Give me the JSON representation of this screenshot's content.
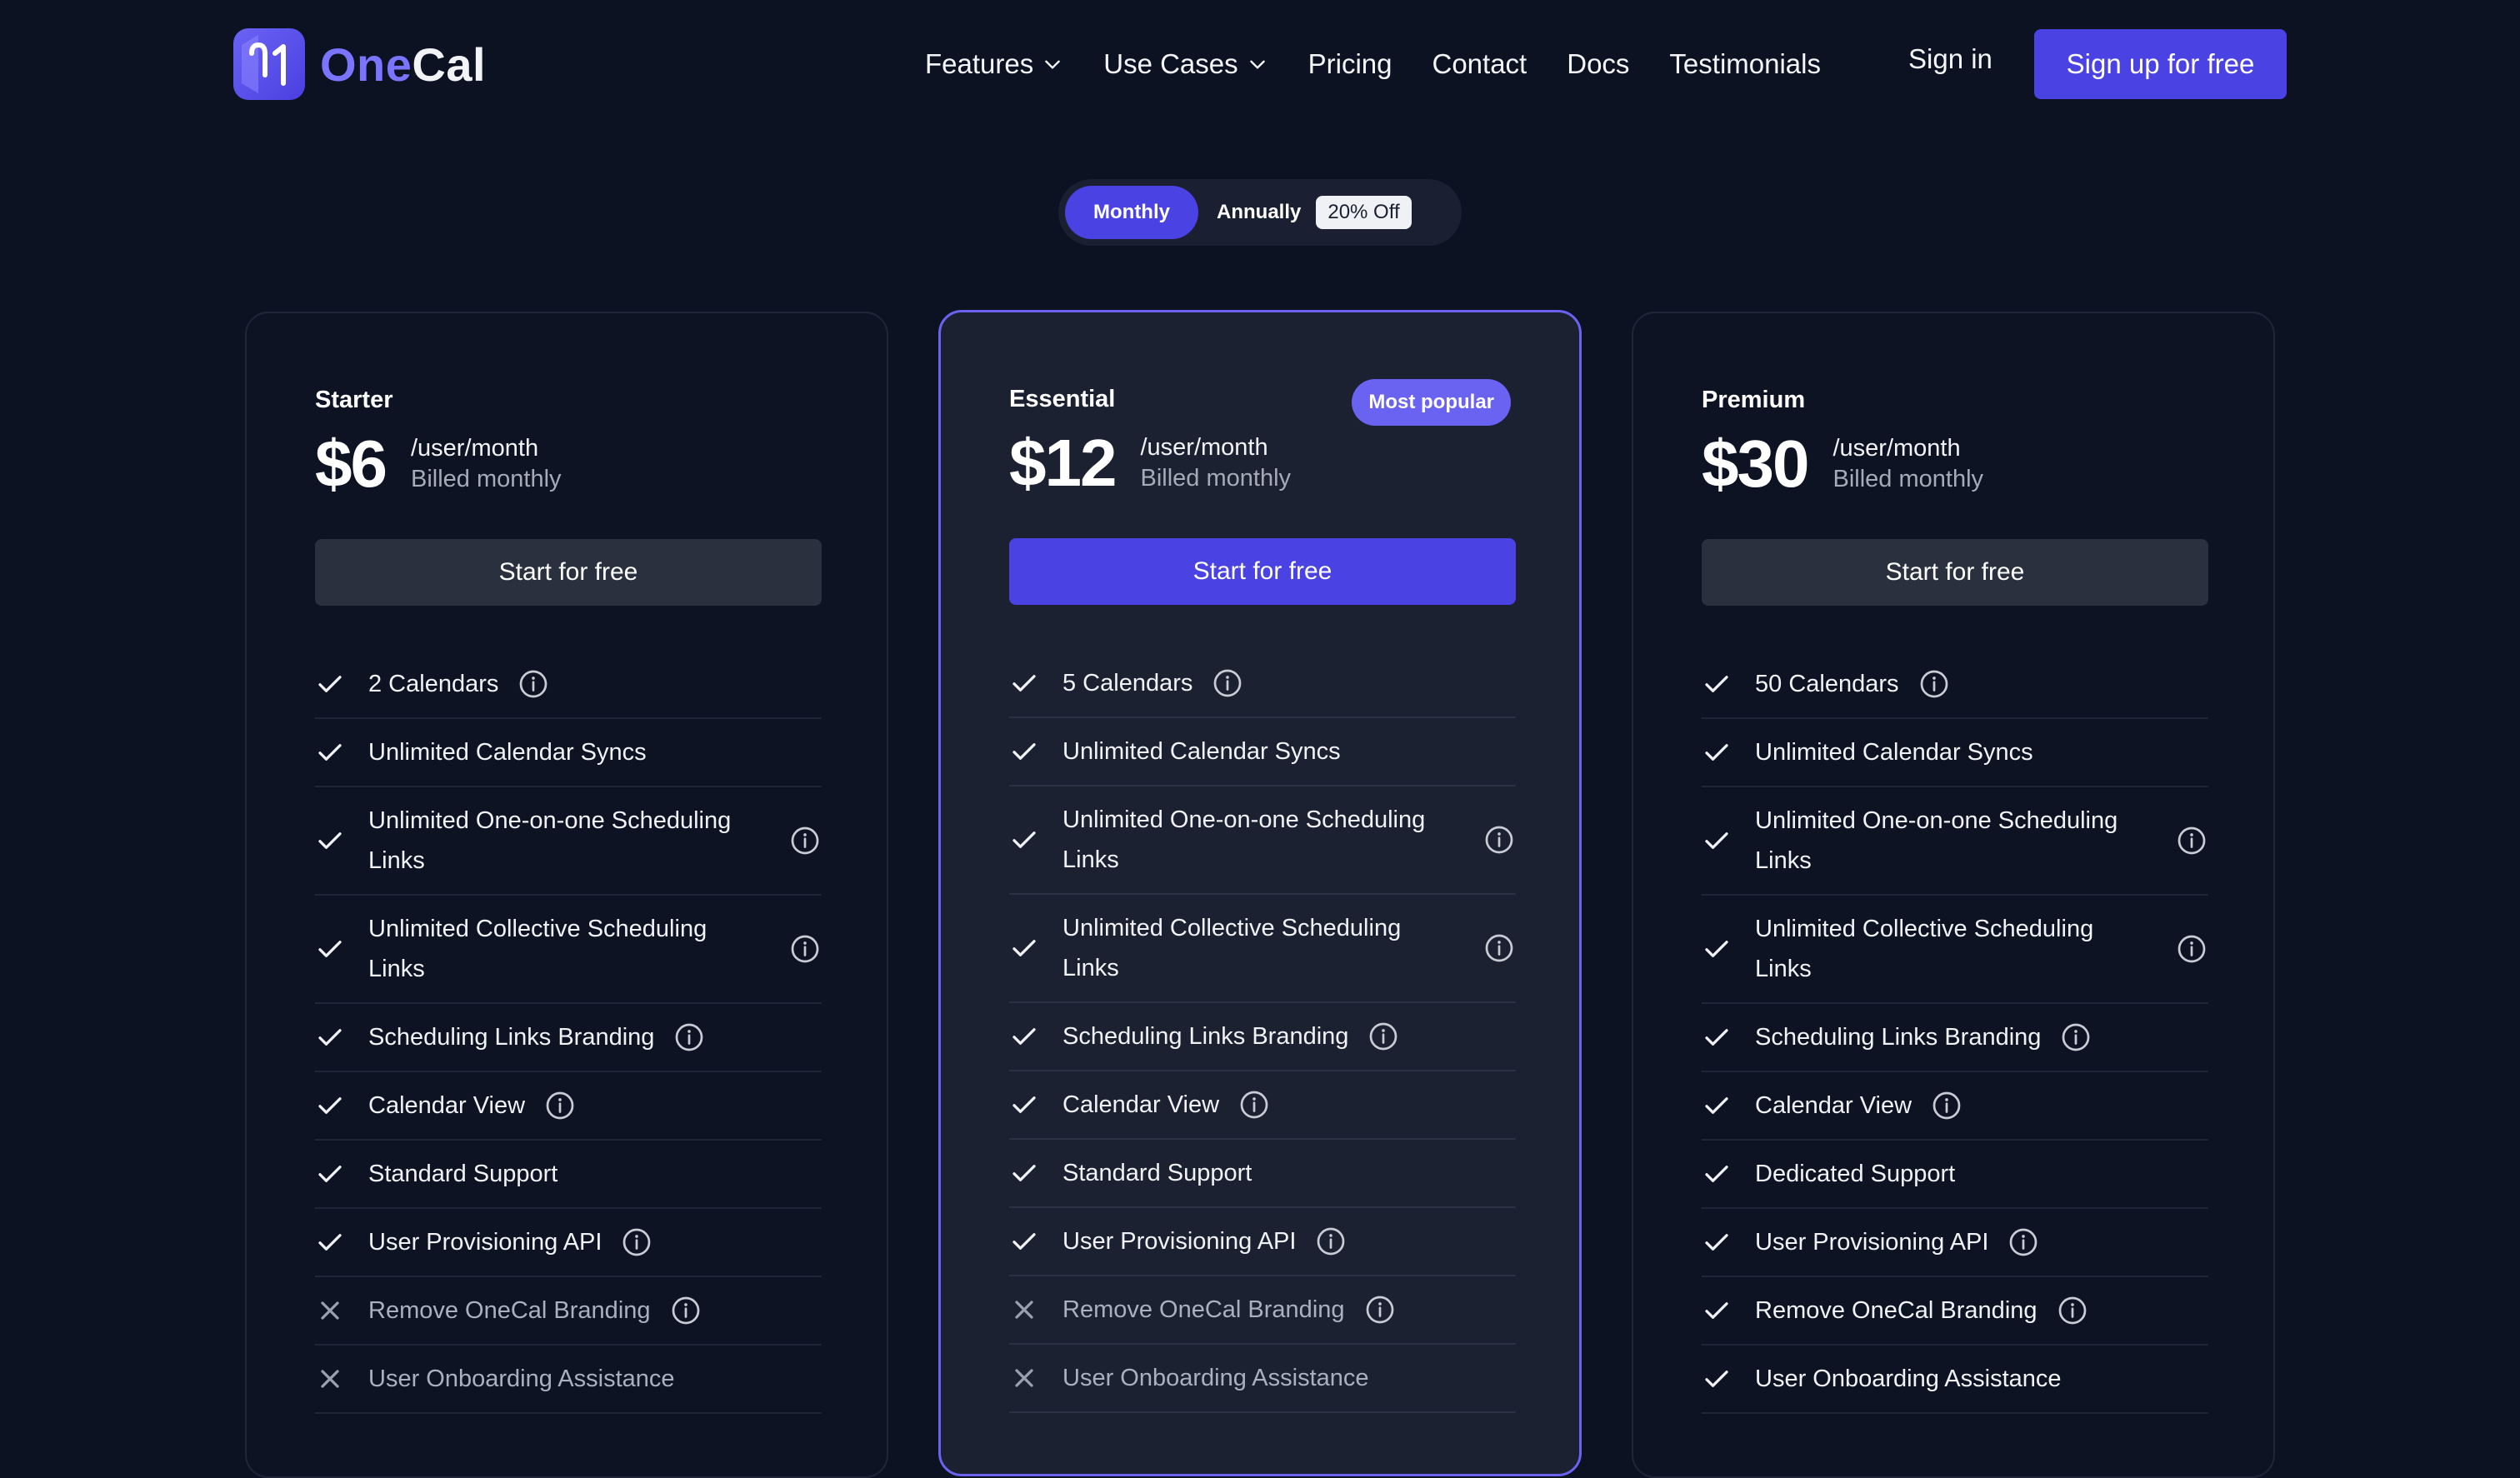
{
  "brand": {
    "one": "One",
    "cal": "Cal"
  },
  "nav": {
    "features": "Features",
    "use_cases": "Use Cases",
    "pricing": "Pricing",
    "contact": "Contact",
    "docs": "Docs",
    "testimonials": "Testimonials",
    "sign_in": "Sign in",
    "sign_up": "Sign up for free"
  },
  "billing_toggle": {
    "monthly": "Monthly",
    "annually": "Annually",
    "discount": "20% Off",
    "selected": "Monthly"
  },
  "plans": [
    {
      "name": "Starter",
      "price": "$6",
      "per": "/user/month",
      "billed": "Billed monthly",
      "cta": "Start for free",
      "features": [
        {
          "label": "2 Calendars",
          "included": true,
          "info": true
        },
        {
          "label": "Unlimited Calendar Syncs",
          "included": true,
          "info": false
        },
        {
          "label": "Unlimited One-on-one Scheduling Links",
          "included": true,
          "info": true
        },
        {
          "label": "Unlimited Collective Scheduling Links",
          "included": true,
          "info": true
        },
        {
          "label": "Scheduling Links Branding",
          "included": true,
          "info": true
        },
        {
          "label": "Calendar View",
          "included": true,
          "info": true
        },
        {
          "label": "Standard Support",
          "included": true,
          "info": false
        },
        {
          "label": "User Provisioning API",
          "included": true,
          "info": true
        },
        {
          "label": "Remove OneCal Branding",
          "included": false,
          "info": true
        },
        {
          "label": "User Onboarding Assistance",
          "included": false,
          "info": false
        }
      ]
    },
    {
      "name": "Essential",
      "price": "$12",
      "per": "/user/month",
      "billed": "Billed monthly",
      "cta": "Start for free",
      "badge": "Most popular",
      "features": [
        {
          "label": "5 Calendars",
          "included": true,
          "info": true
        },
        {
          "label": "Unlimited Calendar Syncs",
          "included": true,
          "info": false
        },
        {
          "label": "Unlimited One-on-one Scheduling Links",
          "included": true,
          "info": true
        },
        {
          "label": "Unlimited Collective Scheduling Links",
          "included": true,
          "info": true
        },
        {
          "label": "Scheduling Links Branding",
          "included": true,
          "info": true
        },
        {
          "label": "Calendar View",
          "included": true,
          "info": true
        },
        {
          "label": "Standard Support",
          "included": true,
          "info": false
        },
        {
          "label": "User Provisioning API",
          "included": true,
          "info": true
        },
        {
          "label": "Remove OneCal Branding",
          "included": false,
          "info": true
        },
        {
          "label": "User Onboarding Assistance",
          "included": false,
          "info": false
        }
      ]
    },
    {
      "name": "Premium",
      "price": "$30",
      "per": "/user/month",
      "billed": "Billed monthly",
      "cta": "Start for free",
      "features": [
        {
          "label": "50 Calendars",
          "included": true,
          "info": true
        },
        {
          "label": "Unlimited Calendar Syncs",
          "included": true,
          "info": false
        },
        {
          "label": "Unlimited One-on-one Scheduling Links",
          "included": true,
          "info": true
        },
        {
          "label": "Unlimited Collective Scheduling Links",
          "included": true,
          "info": true
        },
        {
          "label": "Scheduling Links Branding",
          "included": true,
          "info": true
        },
        {
          "label": "Calendar View",
          "included": true,
          "info": true
        },
        {
          "label": "Dedicated Support",
          "included": true,
          "info": false
        },
        {
          "label": "User Provisioning API",
          "included": true,
          "info": true
        },
        {
          "label": "Remove OneCal Branding",
          "included": true,
          "info": true
        },
        {
          "label": "User Onboarding Assistance",
          "included": true,
          "info": false
        }
      ]
    }
  ],
  "icons": {
    "check": "check-icon",
    "cross": "x-icon",
    "info": "info-icon",
    "chevron": "chevron-down-icon"
  },
  "colors": {
    "background": "#0c1222",
    "accent": "#4b42e3",
    "featured_border": "#6a62f0",
    "brand_one": "#7b74ff"
  }
}
